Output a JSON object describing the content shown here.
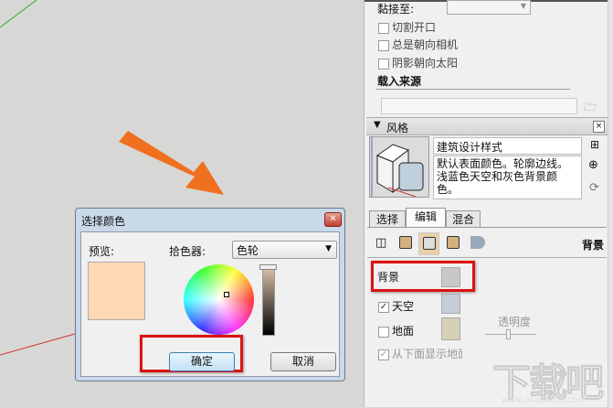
{
  "panel": {
    "glue_label": "黏接至:",
    "checkboxes": [
      {
        "label": "切割开口",
        "checked": false
      },
      {
        "label": "总是朝向相机",
        "checked": false
      },
      {
        "label": "阴影朝向太阳",
        "checked": false
      }
    ],
    "load_source_label": "载入来源",
    "styles_header": "风格",
    "style_name": "建筑设计样式",
    "style_description": "默认表面颜色。轮廓边线。浅蓝色天空和灰色背景颜色。",
    "tabs": [
      "选择",
      "编辑",
      "混合"
    ],
    "active_tab": "编辑",
    "section_title": "背景",
    "background_label": "背景",
    "sky_label": "天空",
    "sky_checked": true,
    "ground_label": "地面",
    "ground_checked": false,
    "transparency_label": "透明度",
    "show_ground_below_label": "从下面显示地面",
    "colors": {
      "background": "#c9c8c6",
      "sky": "#c5cdd5",
      "ground": "#d5d0b6"
    }
  },
  "dialog": {
    "title": "选择颜色",
    "preview_label": "预览:",
    "picker_label": "拾色器:",
    "picker_value": "色轮",
    "ok_label": "确定",
    "cancel_label": "取消",
    "preview_color": "#ffd9b3"
  },
  "watermark": {
    "text": "下载吧",
    "url": "www.xiazaiba.com"
  }
}
